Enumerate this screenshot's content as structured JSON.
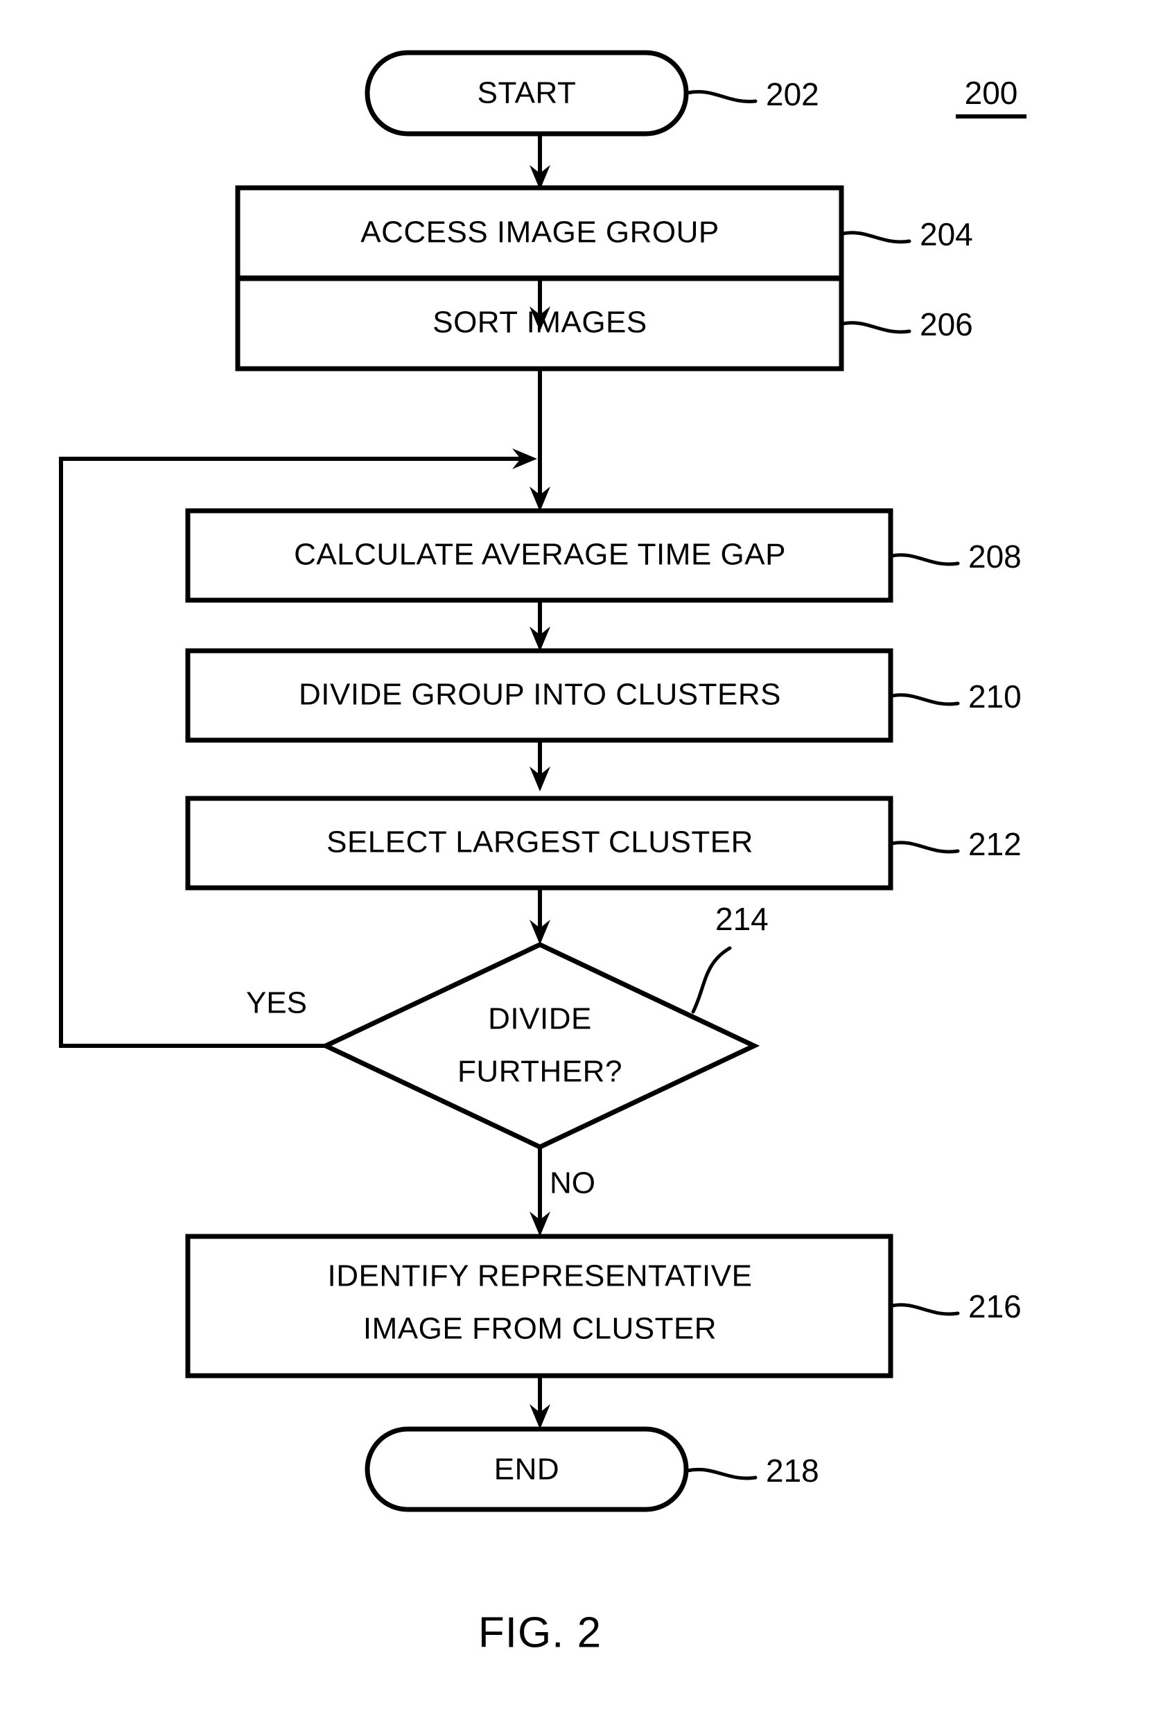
{
  "figure": {
    "caption": "FIG. 2",
    "figure_ref": "200",
    "figure_ref_underlined": true,
    "background_color": "#ffffff",
    "line_color": "#000000"
  },
  "flowchart": {
    "type": "process-flowchart",
    "orientation": "top-to-bottom",
    "nodes": [
      {
        "id": "n202",
        "shape": "terminator",
        "label": "START",
        "ref": "202"
      },
      {
        "id": "n204",
        "shape": "process",
        "label": "ACCESS IMAGE GROUP",
        "ref": "204"
      },
      {
        "id": "n206",
        "shape": "process",
        "label": "SORT IMAGES",
        "ref": "206"
      },
      {
        "id": "n208",
        "shape": "process",
        "label": "CALCULATE AVERAGE TIME GAP",
        "ref": "208"
      },
      {
        "id": "n210",
        "shape": "process",
        "label": "DIVIDE GROUP INTO CLUSTERS",
        "ref": "210"
      },
      {
        "id": "n212",
        "shape": "process",
        "label": "SELECT LARGEST CLUSTER",
        "ref": "212"
      },
      {
        "id": "n214",
        "shape": "decision",
        "label_line1": "DIVIDE",
        "label_line2": "FURTHER?",
        "ref": "214"
      },
      {
        "id": "n216",
        "shape": "process",
        "label_line1": "IDENTIFY REPRESENTATIVE",
        "label_line2": "IMAGE FROM CLUSTER",
        "ref": "216"
      },
      {
        "id": "n218",
        "shape": "terminator",
        "label": "END",
        "ref": "218"
      }
    ],
    "edges": [
      {
        "from": "n202",
        "to": "n204",
        "label": ""
      },
      {
        "from": "n204",
        "to": "n206",
        "label": ""
      },
      {
        "from": "n206",
        "to": "n208",
        "label": ""
      },
      {
        "from": "n208",
        "to": "n210",
        "label": ""
      },
      {
        "from": "n210",
        "to": "n212",
        "label": ""
      },
      {
        "from": "n212",
        "to": "n214",
        "label": ""
      },
      {
        "from": "n214",
        "to": "n208",
        "label": "YES"
      },
      {
        "from": "n214",
        "to": "n216",
        "label": "NO"
      },
      {
        "from": "n216",
        "to": "n218",
        "label": ""
      }
    ],
    "branch_labels": {
      "yes": "YES",
      "no": "NO"
    }
  }
}
